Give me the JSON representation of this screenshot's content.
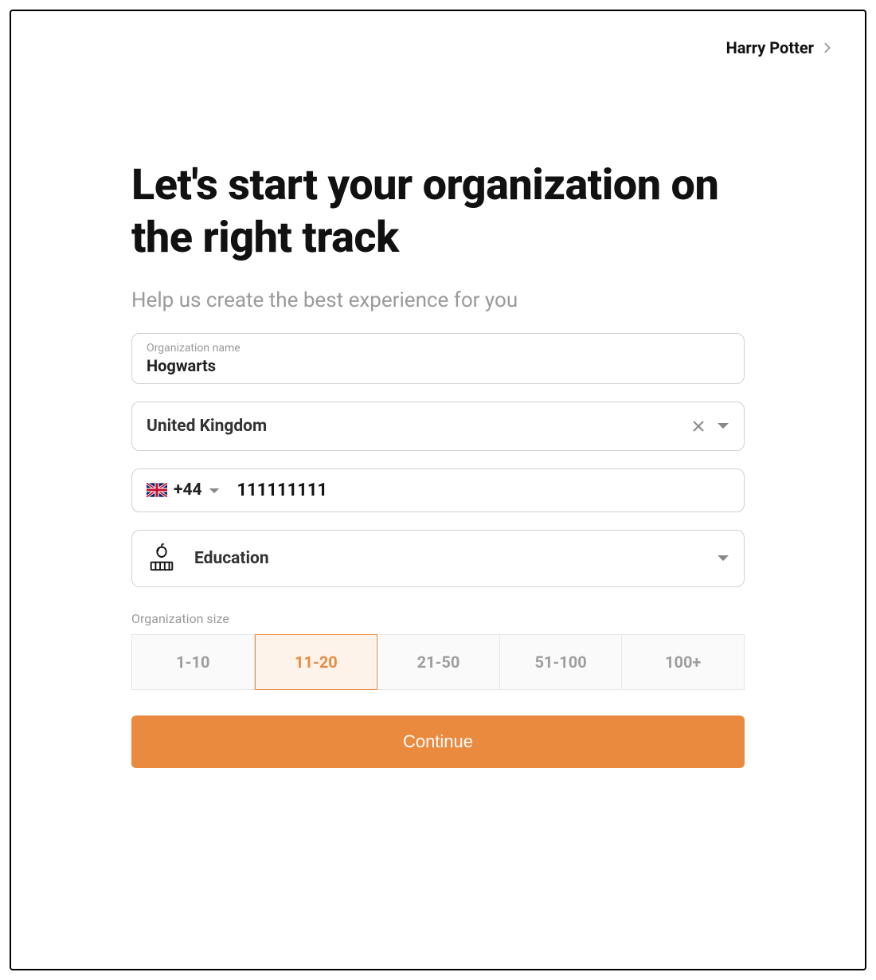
{
  "header": {
    "user_name": "Harry Potter"
  },
  "title": "Let's start your organization on the right track",
  "subtitle": "Help us create the best experience for you",
  "org_name": {
    "label": "Organization name",
    "value": "Hogwarts"
  },
  "country": {
    "value": "United Kingdom"
  },
  "phone": {
    "prefix": "+44",
    "number": "111111111"
  },
  "industry": {
    "value": "Education"
  },
  "size": {
    "label": "Organization size",
    "options": [
      "1-10",
      "11-20",
      "21-50",
      "51-100",
      "100+"
    ],
    "selected": "11-20"
  },
  "continue_label": "Continue"
}
